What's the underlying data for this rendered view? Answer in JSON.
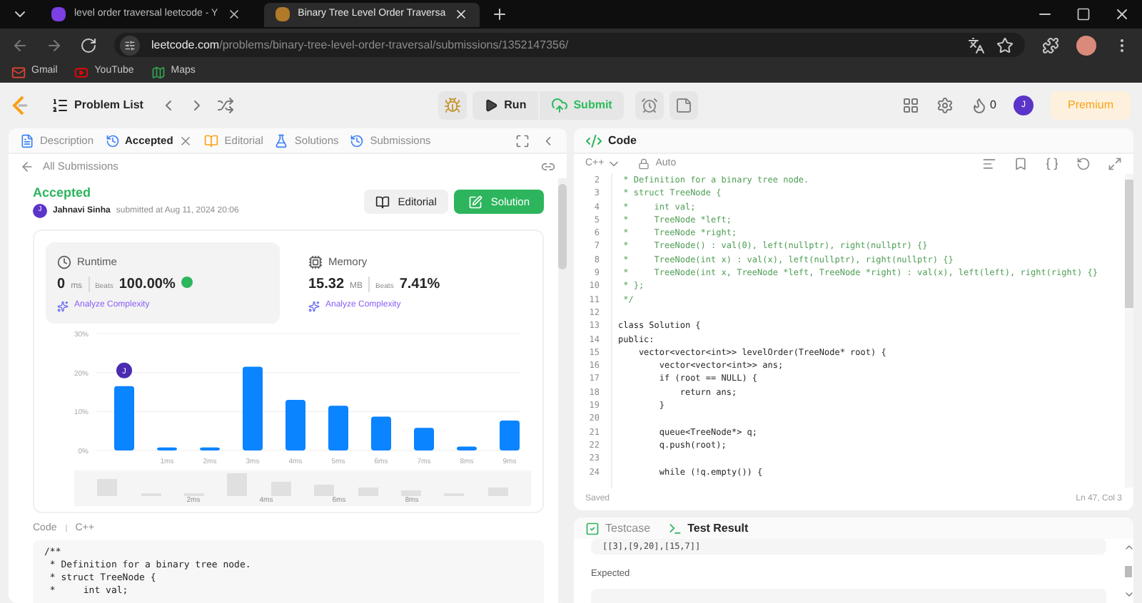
{
  "browser": {
    "tabs": [
      {
        "title": "level order traversal leetcode - Y",
        "selected": false
      },
      {
        "title": "Binary Tree Level Order Traversa",
        "selected": true
      }
    ],
    "url": {
      "domain": "leetcode.com",
      "path": "/problems/binary-tree-level-order-traversal/submissions/1352147356/"
    },
    "bookmarks": [
      "Gmail",
      "YouTube",
      "Maps"
    ]
  },
  "topbar": {
    "problem_list": "Problem List",
    "run": "Run",
    "submit": "Submit",
    "streak": "0",
    "avatar": "J",
    "premium": "Premium"
  },
  "left_panel": {
    "tabs": [
      {
        "label": "Description",
        "selected": false
      },
      {
        "label": "Accepted",
        "selected": true
      },
      {
        "label": "Editorial",
        "selected": false
      },
      {
        "label": "Solutions",
        "selected": false
      },
      {
        "label": "Submissions",
        "selected": false
      }
    ],
    "back_link": "All Submissions",
    "status": "Accepted",
    "author": "Jahnavi Sinha",
    "author_avatar": "J",
    "submitted": "submitted at Aug 11, 2024 20:06",
    "buttons": {
      "editorial": "Editorial",
      "solution": "Solution"
    },
    "stats": [
      {
        "kind": "runtime",
        "title": "Runtime",
        "value": "0",
        "unit": "ms",
        "beats_label": "Beats",
        "beats": "100.00%",
        "analyze": "Analyze Complexity",
        "selected": true
      },
      {
        "kind": "memory",
        "title": "Memory",
        "value": "15.32",
        "unit": "MB",
        "beats_label": "Beats",
        "beats": "7.41%",
        "analyze": "Analyze Complexity",
        "selected": false
      }
    ],
    "chart_data": {
      "type": "bar",
      "categories": [
        null,
        "1ms",
        "2ms",
        "3ms",
        "4ms",
        "5ms",
        "6ms",
        "7ms",
        "8ms",
        "9ms"
      ],
      "series": [
        {
          "color": "#0a84ff",
          "values": [
            16.5,
            0.8,
            0.8,
            21.5,
            13,
            11.5,
            8.7,
            5.8,
            1,
            7.7
          ]
        }
      ],
      "ylim": [
        0,
        30
      ],
      "yticks": [
        {
          "value": 0,
          "label": "0%"
        },
        {
          "value": 10,
          "label": "10%"
        },
        {
          "value": 20,
          "label": "20%"
        },
        {
          "value": 30,
          "label": "30%"
        }
      ],
      "annotations": [
        {
          "y": 16.5,
          "text": "J"
        }
      ]
    },
    "overview_labels": [
      "2ms",
      "4ms",
      "6ms",
      "8ms"
    ],
    "code_label": "Code",
    "code_language": "C++",
    "code_lines": [
      "/**",
      " * Definition for a binary tree node.",
      " * struct TreeNode {",
      " *     int val;"
    ]
  },
  "right_panel": {
    "title": "Code",
    "language": "C++",
    "mode": "Auto",
    "lines": [
      {
        "num": "2",
        "kind": "comment",
        "text": " * Definition for a binary tree node."
      },
      {
        "num": "3",
        "kind": "comment",
        "text": " * struct TreeNode {"
      },
      {
        "num": "4",
        "kind": "comment",
        "text": " *     int val;"
      },
      {
        "num": "5",
        "kind": "comment",
        "text": " *     TreeNode *left;"
      },
      {
        "num": "6",
        "kind": "comment",
        "text": " *     TreeNode *right;"
      },
      {
        "num": "7",
        "kind": "comment",
        "text": " *     TreeNode() : val(0), left(nullptr), right(nullptr) {}"
      },
      {
        "num": "8",
        "kind": "comment",
        "text": " *     TreeNode(int x) : val(x), left(nullptr), right(nullptr) {}"
      },
      {
        "num": "9",
        "kind": "comment",
        "text": " *     TreeNode(int x, TreeNode *left, TreeNode *right) : val(x), left(left), right(right) {}"
      },
      {
        "num": "10",
        "kind": "comment",
        "text": " * };"
      },
      {
        "num": "11",
        "kind": "comment",
        "text": " */"
      },
      {
        "num": "12",
        "kind": "blank"
      },
      {
        "num": "13",
        "kind": "code",
        "text": "class Solution {"
      },
      {
        "num": "14",
        "kind": "code",
        "text": "public:"
      },
      {
        "num": "15",
        "kind": "code",
        "text": "    vector<vector<int>> levelOrder(TreeNode* root) {"
      },
      {
        "num": "16",
        "kind": "code",
        "text": "        vector<vector<int>> ans;"
      },
      {
        "num": "17",
        "kind": "code",
        "text": "        if (root == NULL) {"
      },
      {
        "num": "18",
        "kind": "code",
        "text": "            return ans;"
      },
      {
        "num": "19",
        "kind": "code",
        "text": "        }"
      },
      {
        "num": "20",
        "kind": "blank"
      },
      {
        "num": "21",
        "kind": "code",
        "text": "        queue<TreeNode*> q;"
      },
      {
        "num": "22",
        "kind": "code",
        "text": "        q.push(root);"
      },
      {
        "num": "23",
        "kind": "blank"
      },
      {
        "num": "24",
        "kind": "code",
        "text": "        while (!q.empty()) {"
      }
    ],
    "saved": "Saved",
    "position": "Ln 47, Col 3"
  },
  "test_panel": {
    "tabs": [
      {
        "label": "Testcase",
        "selected": false
      },
      {
        "label": "Test Result",
        "selected": true
      }
    ],
    "output": "[[3],[9,20],[15,7]]",
    "expected_label": "Expected"
  }
}
